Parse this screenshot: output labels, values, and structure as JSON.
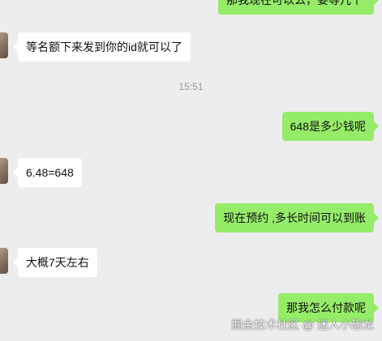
{
  "chat": {
    "messages": [
      {
        "id": "m0",
        "direction": "out",
        "text": "那我现在可以么，要等几个"
      },
      {
        "id": "m1",
        "direction": "in",
        "text": "等名额下来发到你的id就可以了"
      },
      {
        "id": "m2",
        "direction": "out",
        "text": "648是多少钱呢"
      },
      {
        "id": "m3",
        "direction": "in",
        "text": "6.48=648"
      },
      {
        "id": "m4",
        "direction": "out",
        "text": "现在预约 ,多长时间可以到账"
      },
      {
        "id": "m5",
        "direction": "in",
        "text": "大概7天左右"
      },
      {
        "id": "m6",
        "direction": "out",
        "text": "那我怎么付款呢"
      }
    ],
    "timestamp": "15:51"
  },
  "watermark": {
    "text": "掘金技术社区 @ 迷人小恐龙"
  },
  "colors": {
    "background": "#ededed",
    "incoming_bubble": "#ffffff",
    "outgoing_bubble": "#95ec69",
    "timestamp_text": "#9b9b9b"
  }
}
